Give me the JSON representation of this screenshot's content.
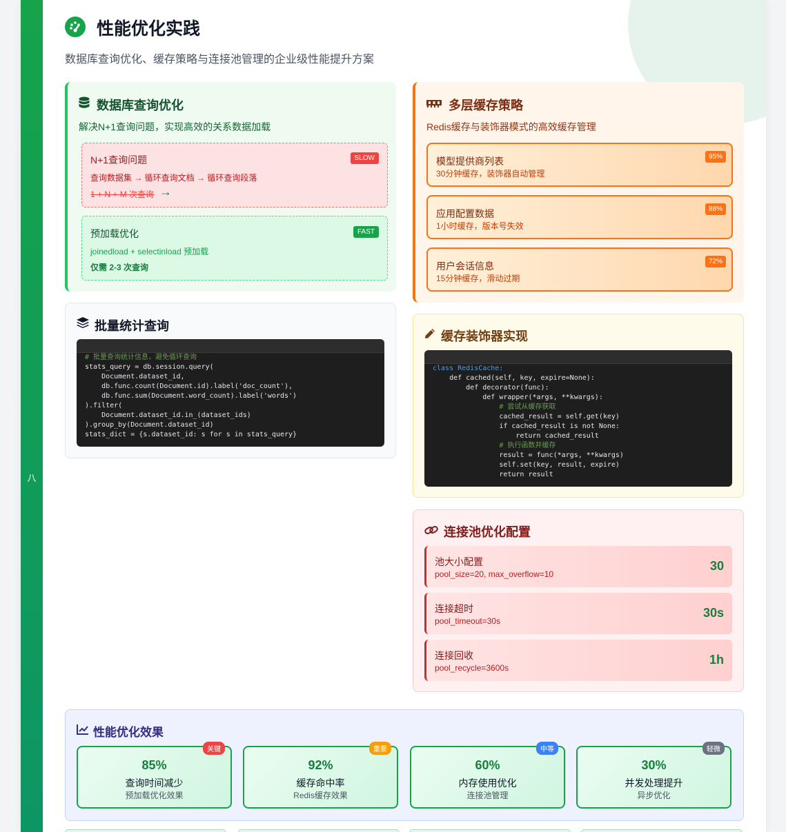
{
  "side_bar": {
    "mark": "八"
  },
  "header": {
    "title": "性能优化实践",
    "subtitle": "数据库查询优化、缓存策略与连接池管理的企业级性能提升方案"
  },
  "db_card": {
    "title": "数据库查询优化",
    "desc": "解决N+1查询问题，实现高效的关系数据加载",
    "issue": {
      "title": "N+1查询问题",
      "tag": "SLOW",
      "flow": "查询数据集 → 循环查询文档 → 循环查询段落",
      "count": "1 + N + M 次查询"
    },
    "fix": {
      "title": "预加载优化",
      "tag": "FAST",
      "method": "joinedload + selectinload 预加载",
      "count": "仅需 2-3 次查询"
    }
  },
  "cache_card": {
    "title": "多层缓存策略",
    "desc": "Redis缓存与装饰器模式的高效缓存管理",
    "items": [
      {
        "title": "模型提供商列表",
        "desc": "30分钟缓存，装饰器自动管理",
        "pct": "95%"
      },
      {
        "title": "应用配置数据",
        "desc": "1小时缓存，版本号失效",
        "pct": "88%"
      },
      {
        "title": "用户会话信息",
        "desc": "15分钟缓存，滑动过期",
        "pct": "72%"
      }
    ]
  },
  "batch_card": {
    "title": "批量统计查询",
    "code": [
      "# 批量查询统计信息，避免循环查询",
      "stats_query = db.session.query(",
      "    Document.dataset_id,",
      "    db.func.count(Document.id).label('doc_count'),",
      "    db.func.sum(Document.word_count).label('words')",
      ").filter(",
      "    Document.dataset_id.in_(dataset_ids)",
      ").group_by(Document.dataset_id)",
      "stats_dict = {s.dataset_id: s for s in stats_query}"
    ]
  },
  "decorator_card": {
    "title": "缓存装饰器实现",
    "code": [
      "class RedisCache:",
      "    def cached(self, key, expire=None):",
      "        def decorator(func):",
      "            def wrapper(*args, **kwargs):",
      "                # 尝试从缓存获取",
      "                cached_result = self.get(key)",
      "                if cached_result is not None:",
      "                    return cached_result",
      "                # 执行函数并缓存",
      "                result = func(*args, **kwargs)",
      "                self.set(key, result, expire)",
      "                return result"
    ]
  },
  "pool_card": {
    "title": "连接池优化配置",
    "items": [
      {
        "title": "池大小配置",
        "desc": "pool_size=20, max_overflow=10",
        "value": "30"
      },
      {
        "title": "连接超时",
        "desc": "pool_timeout=30s",
        "value": "30s"
      },
      {
        "title": "连接回收",
        "desc": "pool_recycle=3600s",
        "value": "1h"
      }
    ]
  },
  "effect_card": {
    "title": "性能优化效果",
    "metrics": [
      {
        "value": "85%",
        "title": "查询时间减少",
        "desc": "预加载优化效果",
        "badge": "关键",
        "badge_color": "#ef4444"
      },
      {
        "value": "92%",
        "title": "缓存命中率",
        "desc": "Redis缓存效果",
        "badge": "重要",
        "badge_color": "#f59e0b"
      },
      {
        "value": "60%",
        "title": "内存使用优化",
        "desc": "连接池管理",
        "badge": "中等",
        "badge_color": "#3b82f6"
      },
      {
        "value": "30%",
        "title": "并发处理提升",
        "desc": "异步优化",
        "badge": "轻微",
        "badge_color": "#6b7280"
      }
    ]
  },
  "icons": {
    "header": "gauge-icon",
    "db": "database-icon",
    "cache": "memory-icon",
    "batch": "layers-icon",
    "decorator": "pen-icon",
    "pool": "link-icon",
    "effect": "chart-line-icon"
  }
}
